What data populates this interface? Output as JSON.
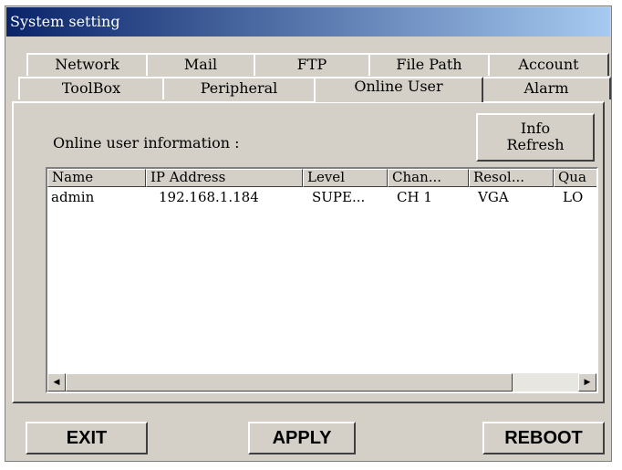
{
  "window": {
    "title": "System setting"
  },
  "tabs": {
    "row_back": [
      "Network",
      "Mail",
      "FTP",
      "File Path",
      "Account"
    ],
    "row_front": [
      "ToolBox",
      "Peripheral",
      "Online User",
      "Alarm"
    ],
    "active": "Online User"
  },
  "online_user": {
    "info_label": "Online user information :",
    "refresh_button": "Info\nRefresh",
    "columns": [
      "Name",
      "IP Address",
      "Level",
      "Chan...",
      "Resol...",
      "Qua"
    ],
    "rows": [
      [
        "admin",
        "192.168.1.184",
        "SUPE...",
        "CH 1",
        "VGA",
        "LO"
      ]
    ]
  },
  "scrollbar": {
    "left_arrow": "◀",
    "right_arrow": "▶"
  },
  "buttons": {
    "exit": "EXIT",
    "apply": "APPLY",
    "reboot": "REBOOT"
  }
}
